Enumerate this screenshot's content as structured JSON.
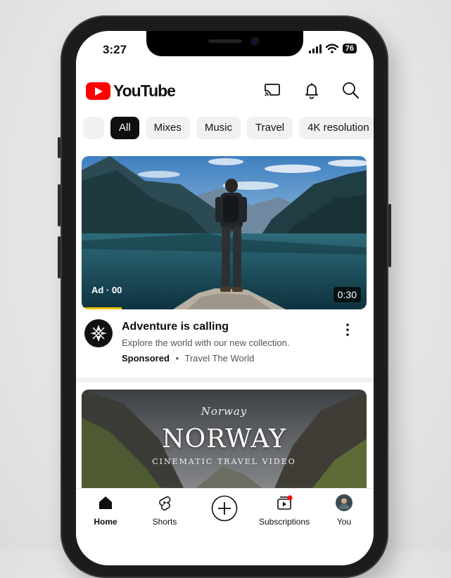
{
  "status_bar": {
    "time": "3:27",
    "battery": "76"
  },
  "header": {
    "logo_text": "YouTube",
    "icons": [
      "cast-icon",
      "bell-icon",
      "search-icon"
    ]
  },
  "chips": [
    "",
    "All",
    "Mixes",
    "Music",
    "Travel",
    "4K resolution"
  ],
  "ad_video": {
    "overlay_label": "Ad · 00",
    "duration": "0:30",
    "title": "Adventure is calling",
    "description": "Explore the world with our new collection.",
    "sponsored_label": "Sponsored",
    "separator": "•",
    "advertiser": "Travel The World",
    "progress": 0.14
  },
  "next_video": {
    "thumbnail_script": "Norway",
    "thumbnail_title": "NORWAY",
    "thumbnail_subtitle": "CINEMATIC TRAVEL VIDEO"
  },
  "bottom_nav": [
    {
      "label": "Home",
      "icon": "home-icon"
    },
    {
      "label": "Shorts",
      "icon": "shorts-icon"
    },
    {
      "label": "",
      "icon": "create-icon"
    },
    {
      "label": "Subscriptions",
      "icon": "subscriptions-icon"
    },
    {
      "label": "You",
      "icon": "profile-avatar-icon"
    }
  ],
  "colors": {
    "brand_red": "#ff0000",
    "active_chip": "#0f0f0f",
    "progress_yellow": "#f2c200"
  }
}
